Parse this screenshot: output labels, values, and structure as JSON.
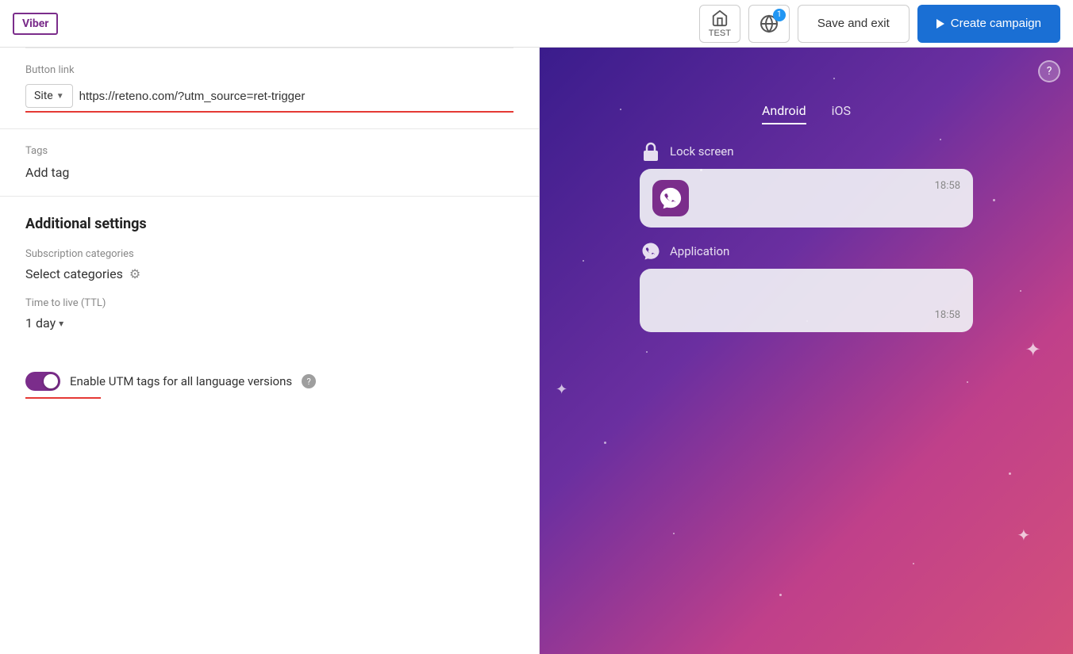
{
  "header": {
    "logo_label": "Viber",
    "test_label": "TEST",
    "save_exit_label": "Save and exit",
    "create_campaign_label": "Create campaign"
  },
  "left_panel": {
    "button_link_label": "Button link",
    "site_dropdown_label": "Site",
    "url_value": "https://reteno.com/?utm_source=ret-trigger",
    "tags_label": "Tags",
    "add_tag_label": "Add tag",
    "additional_settings_title": "Additional settings",
    "subscription_label": "Subscription categories",
    "select_categories_label": "Select categories",
    "ttl_label": "Time to live (TTL)",
    "ttl_value": "1 day",
    "utm_toggle_label": "Enable UTM tags for all language versions"
  },
  "right_panel": {
    "tab_android": "Android",
    "tab_ios": "iOS",
    "lock_screen_label": "Lock screen",
    "application_label": "Application",
    "time_1": "18:58",
    "time_2": "18:58",
    "help_label": "?"
  }
}
